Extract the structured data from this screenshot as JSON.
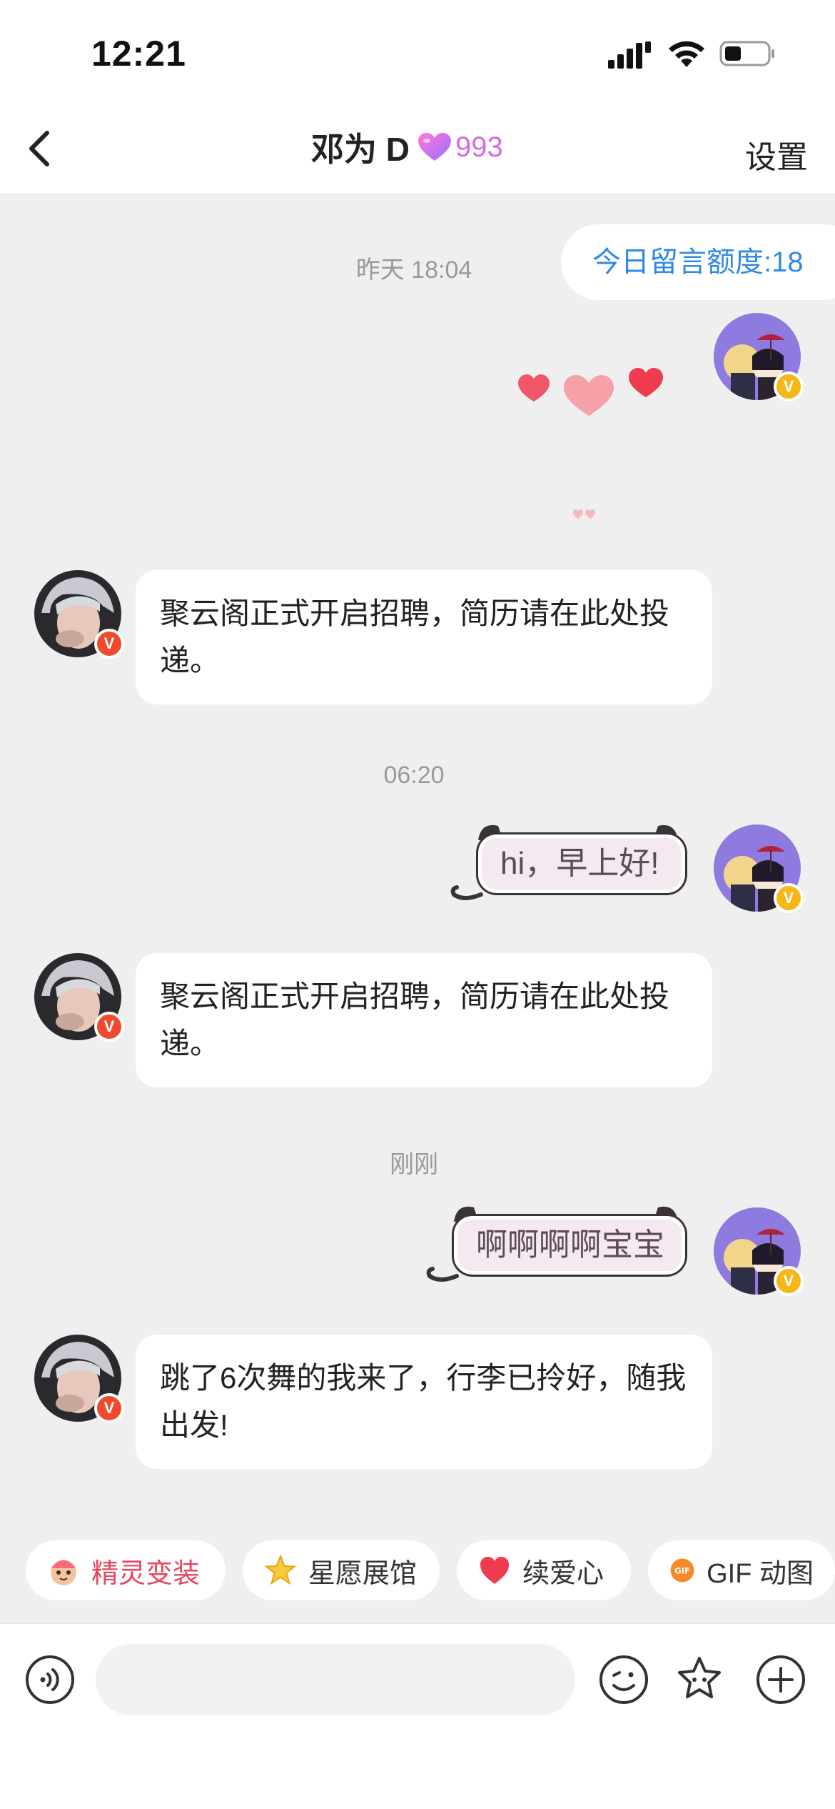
{
  "status_bar": {
    "time": "12:21"
  },
  "header": {
    "title": "邓为 D",
    "intimacy_value": "993",
    "settings_label": "设置"
  },
  "quota_pill": "今日留言额度:18",
  "timestamps": [
    "昨天 18:04",
    "06:20",
    "刚刚"
  ],
  "messages": [
    {
      "side": "incoming",
      "text": "聚云阁正式开启招聘，简历请在此处投递。"
    },
    {
      "side": "outgoing",
      "text": "hi，早上好!"
    },
    {
      "side": "incoming",
      "text": "聚云阁正式开启招聘，简历请在此处投递。"
    },
    {
      "side": "outgoing",
      "text": "啊啊啊啊宝宝"
    },
    {
      "side": "incoming",
      "text": "跳了6次舞的我来了，行李已拎好，随我出发!"
    }
  ],
  "chips": [
    {
      "label": "精灵变装",
      "icon": "sprite-costume-icon",
      "color": "#e8455d"
    },
    {
      "label": "星愿展馆",
      "icon": "star-icon",
      "color": "#333333"
    },
    {
      "label": "续爱心",
      "icon": "heart-icon",
      "color": "#333333"
    },
    {
      "label": "GIF 动图",
      "icon": "gif-icon",
      "color": "#333333"
    }
  ],
  "input": {
    "placeholder": ""
  },
  "colors": {
    "accent_blue": "#2f8ae6",
    "intimacy_pink": "#d46ae0",
    "verified_badge": "#f7b719",
    "creator_badge": "#f04a2d"
  }
}
